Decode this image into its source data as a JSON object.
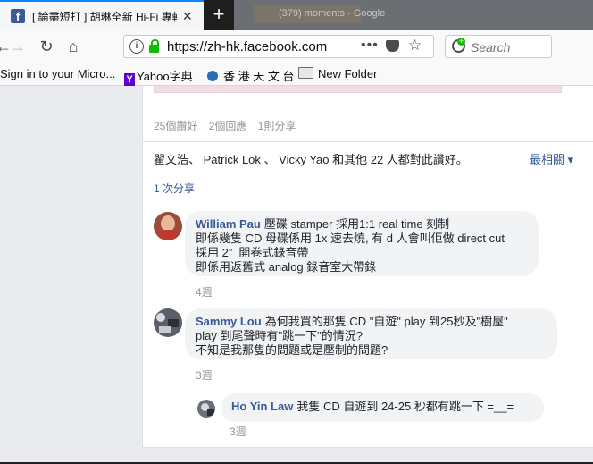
{
  "browser": {
    "tab_title": "[ 論盡短打 ] 胡琳全新 Hi-Fi 專輯",
    "bg_tab_title": "(379) moments - Google",
    "url": "https://zh-hk.facebook.com",
    "search_placeholder": "Search",
    "bookmarks": [
      {
        "label": "Sign in to your Micro..."
      },
      {
        "label": "Yahoo字典"
      },
      {
        "label": "香 港 天 文 台"
      },
      {
        "label": "New Folder"
      }
    ]
  },
  "post": {
    "stats": {
      "likes": "25個讚好",
      "comments": "2個回應",
      "shares": "1則分享"
    },
    "likers_text": "翟文浩、 Patrick Lok 、 Vicky Yao 和其他 22 人都對此讚好。",
    "sort_label": "最相關 ▾",
    "share_count": "1 次分享"
  },
  "comments": [
    {
      "author": "William Pau",
      "lines": [
        "壓碟 stamper 採用1:1 real time 刻制",
        "即係幾隻 CD 母碟係用 1x 速去燒, 有 d 人會叫佢做 direct cut",
        "採用 2”  開卷式錄音帶",
        "即係用返舊式 analog 錄音室大帶錄"
      ],
      "time": "4週"
    },
    {
      "author": "Sammy Lou",
      "lines": [
        "為何我買的那隻 CD \"自遊\" play 到25秒及\"樹屋\"",
        "play 到尾聲時有\"跳一下\"的情況?",
        "不知是我那隻的問題或是壓制的問題?"
      ],
      "time": "3週"
    },
    {
      "author": "Ho Yin Law",
      "lines": [
        "我隻 CD 自遊到 24-25 秒都有跳一下 =__="
      ],
      "time": "3週"
    }
  ]
}
